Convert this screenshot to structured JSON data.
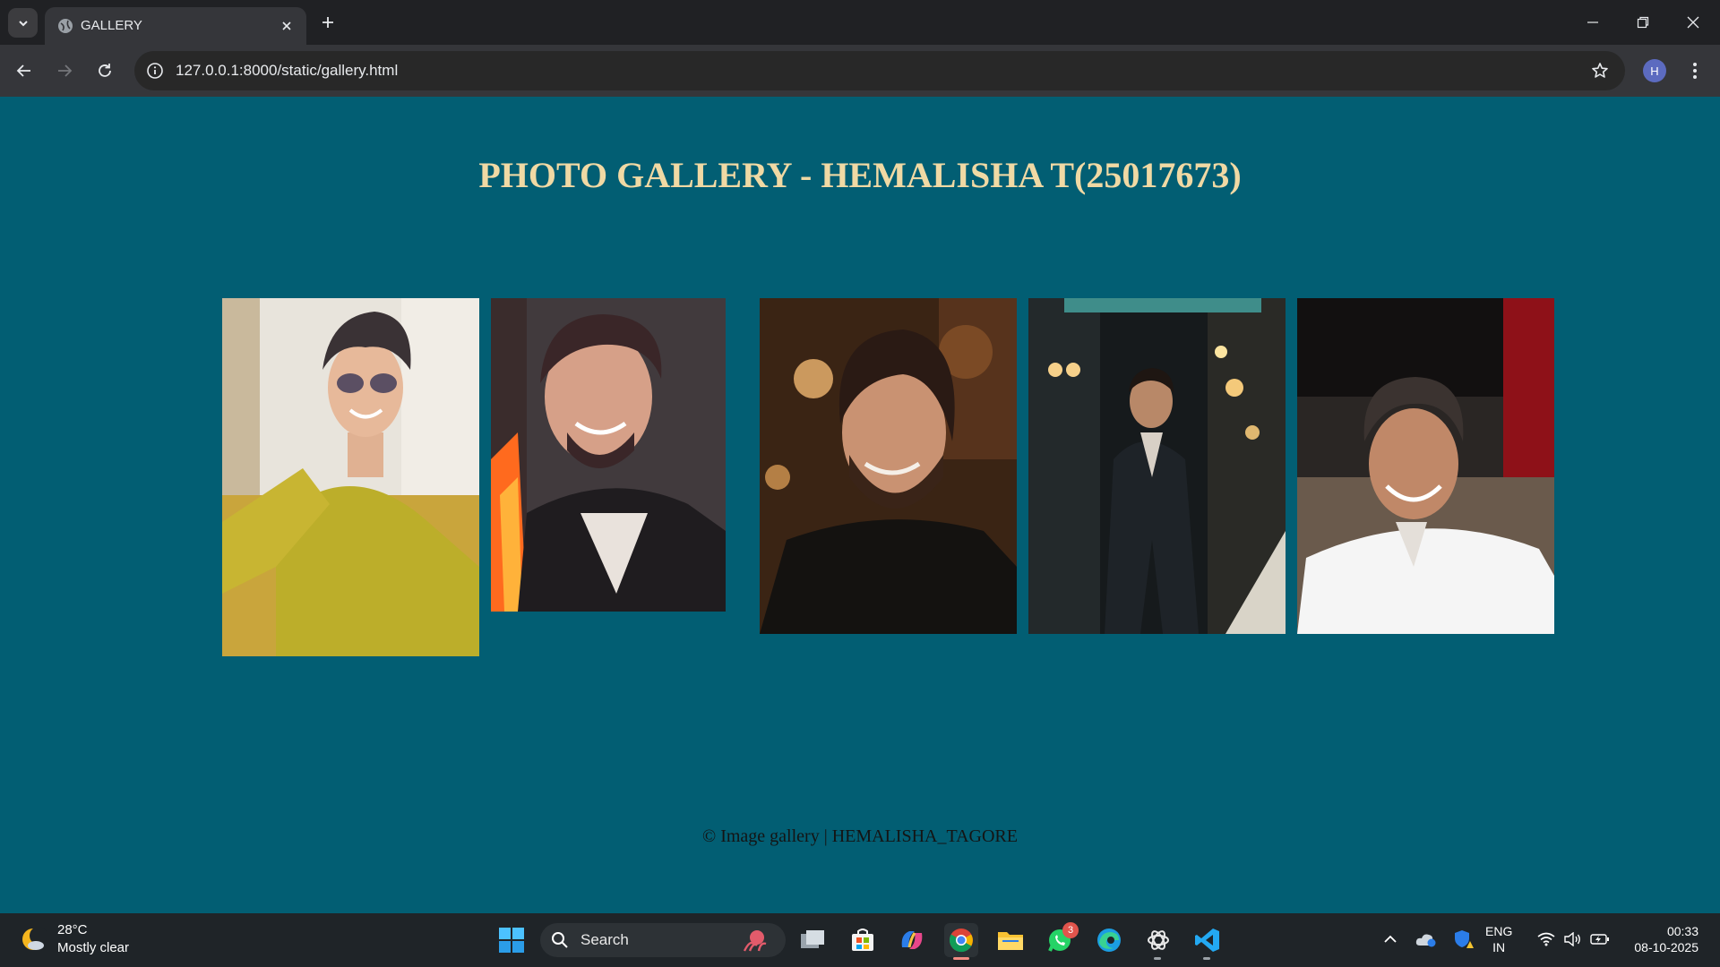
{
  "browser": {
    "tab_title": "GALLERY",
    "url": "127.0.0.1:8000/static/gallery.html",
    "profile_initial": "H"
  },
  "page": {
    "title": "PHOTO GALLERY - HEMALISHA T(25017673)",
    "footer": "© Image gallery | HEMALISHA_TAGORE",
    "background": "#025e73",
    "title_color": "#f0d9a4",
    "photos": [
      {
        "subject": "man in yellow kurta with sunglasses"
      },
      {
        "subject": "smiling man in dark shirt"
      },
      {
        "subject": "man with beard in black outfit"
      },
      {
        "subject": "man in suit standing outdoors at night"
      },
      {
        "subject": "smiling man in white shirt"
      }
    ]
  },
  "taskbar": {
    "weather_temp": "28°C",
    "weather_desc": "Mostly clear",
    "search_label": "Search",
    "whatsapp_badge": "3",
    "lang_top": "ENG",
    "lang_bottom": "IN",
    "time": "00:33",
    "date": "08-10-2025"
  }
}
